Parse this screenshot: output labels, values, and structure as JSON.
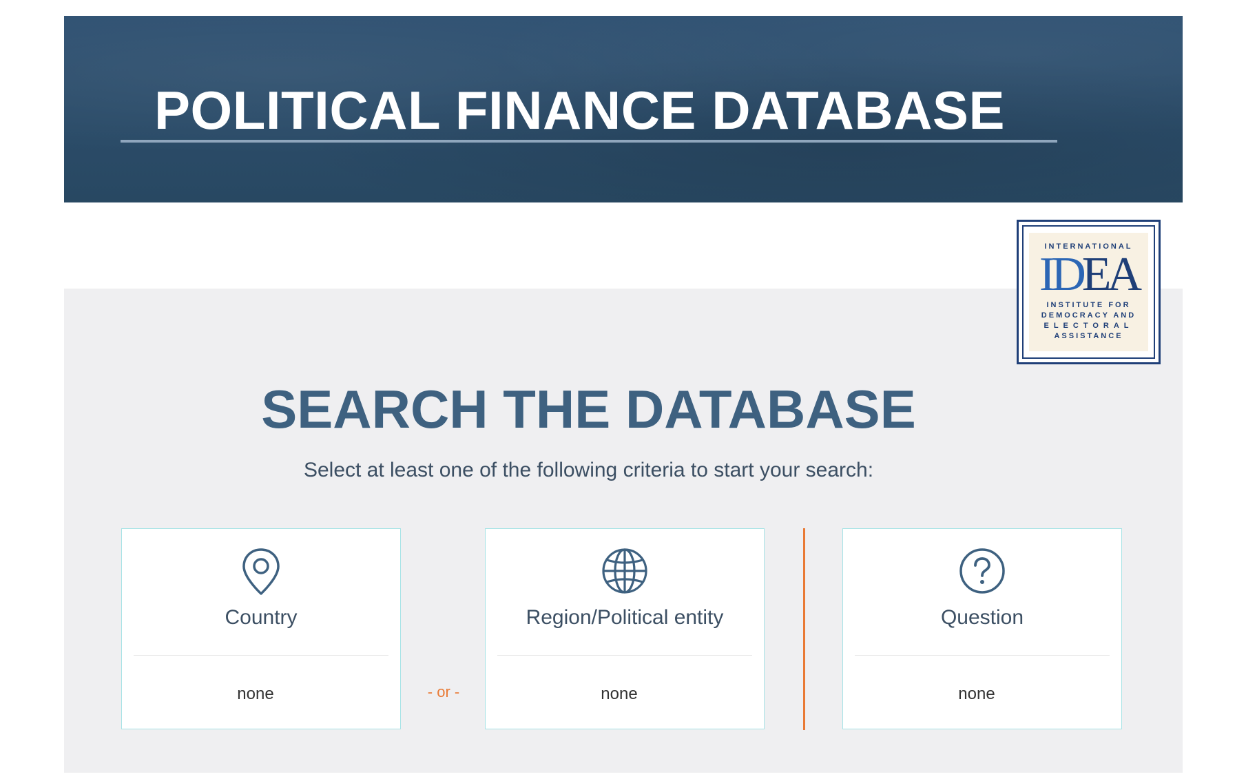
{
  "header": {
    "title": "POLITICAL FINANCE DATABASE"
  },
  "logo": {
    "top_text": "INTERNATIONAL",
    "mark_a": "ID",
    "mark_b": "EA",
    "lines": [
      "INSTITUTE FOR",
      "DEMOCRACY AND",
      "ELECTORAL",
      "ASSISTANCE"
    ]
  },
  "search": {
    "heading": "SEARCH THE DATABASE",
    "subtitle": "Select at least one of the following criteria to start your search:",
    "separator": "- or -",
    "cards": [
      {
        "label": "Country",
        "value": "none",
        "icon": "location-pin-icon"
      },
      {
        "label": "Region/Political entity",
        "value": "none",
        "icon": "globe-icon"
      },
      {
        "label": "Question",
        "value": "none",
        "icon": "question-circle-icon"
      }
    ]
  },
  "colors": {
    "banner": "#2b4c6a",
    "heading": "#3e6180",
    "accent_orange": "#e97a35",
    "card_border": "#a7e3e6",
    "logo_blue": "#1f3f78"
  }
}
